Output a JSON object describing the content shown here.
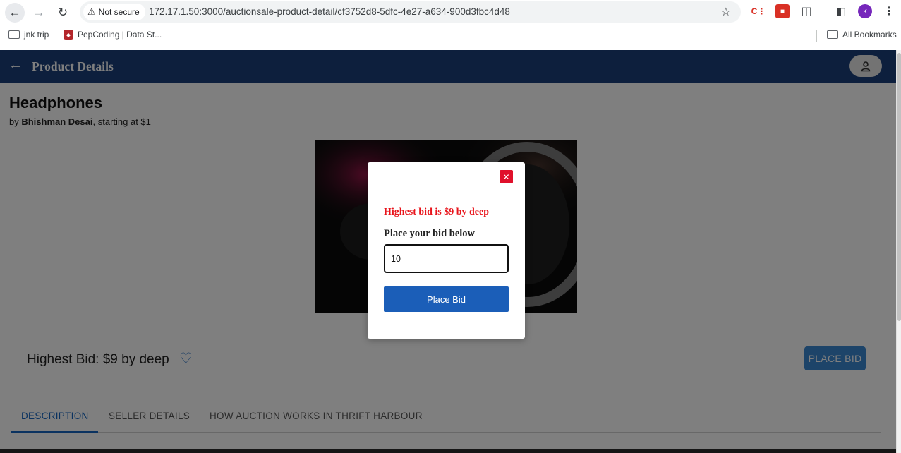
{
  "browser": {
    "security_label": "Not secure",
    "url": "172.17.1.50:3000/auctionsale-product-detail/cf3752d8-5dfc-4e27-a634-900d3fbc4d48",
    "profile_initial": "k",
    "bookmarks": [
      {
        "label": "jnk trip",
        "icon": "folder-icon"
      },
      {
        "label": "PepCoding | Data St...",
        "icon": "pepcoding-icon"
      }
    ],
    "all_bookmarks_label": "All Bookmarks"
  },
  "app": {
    "header_title": "Product Details",
    "product": {
      "title": "Headphones",
      "by_prefix": "by ",
      "seller": "Bhishman Desai",
      "starting_suffix": ", starting at $1"
    },
    "highest_bid_text": "Highest Bid: $9 by deep",
    "place_bid_button": "PLACE BID",
    "tabs": [
      {
        "label": "DESCRIPTION",
        "active": true
      },
      {
        "label": "SELLER DETAILS",
        "active": false
      },
      {
        "label": "HOW AUCTION WORKS IN THRIFT HARBOUR",
        "active": false
      }
    ]
  },
  "modal": {
    "highest_bid_message": "Highest bid is $9 by deep",
    "prompt": "Place your bid below",
    "bid_value": "10",
    "submit_label": "Place Bid",
    "close_symbol": "✕"
  },
  "colors": {
    "appbar": "#1b3f7a",
    "accent_blue": "#1565c0",
    "modal_button": "#1b5eb8",
    "alert_red": "#e8141b"
  }
}
